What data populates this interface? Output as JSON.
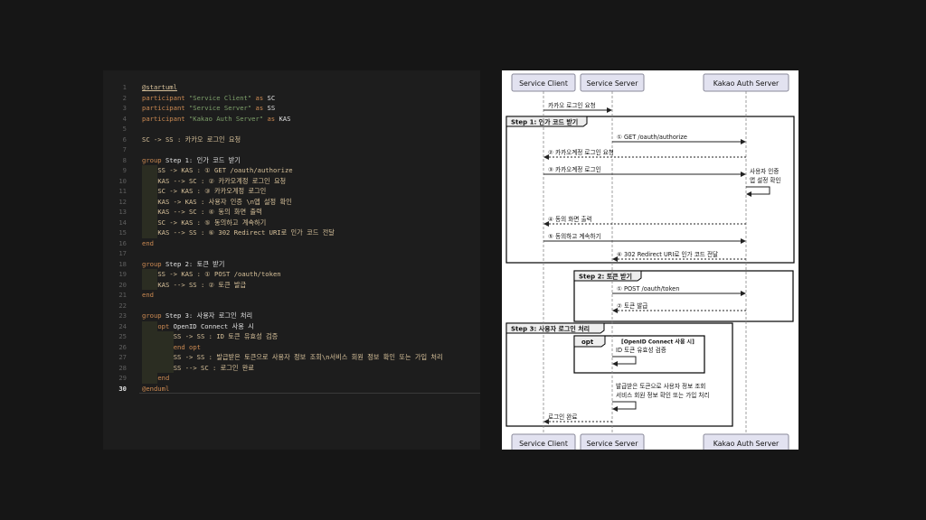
{
  "editor": {
    "current_line": 30,
    "lines": [
      [
        {
          "c": "at",
          "t": "@startuml"
        }
      ],
      [
        {
          "c": "kw",
          "t": "participant "
        },
        {
          "c": "str",
          "t": "\"Service Client\""
        },
        {
          "c": "kw",
          "t": " as "
        },
        {
          "c": "id",
          "t": "SC"
        }
      ],
      [
        {
          "c": "kw",
          "t": "participant "
        },
        {
          "c": "str",
          "t": "\"Service Server\""
        },
        {
          "c": "kw",
          "t": " as "
        },
        {
          "c": "id",
          "t": "SS"
        }
      ],
      [
        {
          "c": "kw",
          "t": "participant "
        },
        {
          "c": "str",
          "t": "\"Kakao Auth Server\""
        },
        {
          "c": "kw",
          "t": " as "
        },
        {
          "c": "id",
          "t": "KAS"
        }
      ],
      [],
      [
        {
          "c": "txt",
          "t": "SC -> SS : 카카오 로그인 요청"
        }
      ],
      [],
      [
        {
          "c": "kw",
          "t": "group "
        },
        {
          "c": "id",
          "t": "Step 1: 인가 코드 받기"
        }
      ],
      [
        {
          "c": "txt",
          "t": "SS -> KAS : ① GET /oauth/authorize"
        }
      ],
      [
        {
          "c": "txt",
          "t": "KAS --> SC : ② 카카오계정 로그인 요청"
        }
      ],
      [
        {
          "c": "txt",
          "t": "SC -> KAS : ③ 카카오계정 로그인"
        }
      ],
      [
        {
          "c": "txt",
          "t": "KAS -> KAS : 사용자 인증 \\n앱 설정 확인"
        }
      ],
      [
        {
          "c": "txt",
          "t": "KAS --> SC : ④ 동의 화면 출력"
        }
      ],
      [
        {
          "c": "txt",
          "t": "SC -> KAS : ⑤ 동의하고 계속하기"
        }
      ],
      [
        {
          "c": "txt",
          "t": "KAS --> SS : ⑥ 302 Redirect URI로 인가 코드 전달"
        }
      ],
      [
        {
          "c": "kw",
          "t": "end"
        }
      ],
      [],
      [
        {
          "c": "kw",
          "t": "group "
        },
        {
          "c": "id",
          "t": "Step 2: 토큰 받기"
        }
      ],
      [
        {
          "c": "txt",
          "t": "SS -> KAS : ① POST /oauth/token"
        }
      ],
      [
        {
          "c": "txt",
          "t": "KAS --> SS : ② 토큰 발급"
        }
      ],
      [
        {
          "c": "kw",
          "t": "end"
        }
      ],
      [],
      [
        {
          "c": "kw",
          "t": "group "
        },
        {
          "c": "id",
          "t": "Step 3: 사용자 로그인 처리"
        }
      ],
      [
        {
          "c": "kw",
          "t": "opt "
        },
        {
          "c": "id",
          "t": "OpenID Connect 사용 시"
        }
      ],
      [
        {
          "c": "txt",
          "t": "SS -> SS : ID 토큰 유효성 검증"
        }
      ],
      [
        {
          "c": "kw",
          "t": "end opt"
        }
      ],
      [
        {
          "c": "txt",
          "t": "SS -> SS : 발급받은 토큰으로 사용자 정보 조회\\n서비스 회원 정보 확인 또는 가입 처리"
        }
      ],
      [
        {
          "c": "txt",
          "t": "SS --> SC : 로그인 완료"
        }
      ],
      [
        {
          "c": "kw",
          "t": "end"
        }
      ],
      [
        {
          "c": "kw",
          "t": "@enduml"
        }
      ]
    ],
    "indent": [
      0,
      0,
      0,
      0,
      0,
      0,
      0,
      0,
      1,
      1,
      1,
      1,
      1,
      1,
      1,
      0,
      0,
      0,
      1,
      1,
      0,
      0,
      0,
      1,
      2,
      2,
      2,
      2,
      1,
      0
    ]
  },
  "diagram": {
    "participants": [
      "Service Client",
      "Service Server",
      "Kakao Auth Server"
    ],
    "groups": [
      {
        "label": "Step 1: 인가 코드 받기"
      },
      {
        "label": "Step 2: 토큰 받기"
      },
      {
        "label": "Step 3: 사용자 로그인 처리"
      }
    ],
    "opt": {
      "label": "opt",
      "condition": "[OpenID Connect 사용 시]"
    },
    "messages": [
      {
        "from": 0,
        "to": 1,
        "dashed": false,
        "lines": [
          "카카오 로그인 요청"
        ]
      },
      {
        "from": 1,
        "to": 2,
        "dashed": false,
        "lines": [
          "① GET /oauth/authorize"
        ]
      },
      {
        "from": 2,
        "to": 0,
        "dashed": true,
        "lines": [
          "② 카카오계정 로그인 요청"
        ]
      },
      {
        "from": 0,
        "to": 2,
        "dashed": false,
        "lines": [
          "③ 카카오계정 로그인"
        ]
      },
      {
        "from": 2,
        "to": 2,
        "dashed": false,
        "lines": [
          "사용자 인증",
          "앱 설정 확인"
        ]
      },
      {
        "from": 2,
        "to": 0,
        "dashed": true,
        "lines": [
          "④ 동의 화면 출력"
        ]
      },
      {
        "from": 0,
        "to": 2,
        "dashed": false,
        "lines": [
          "⑤ 동의하고 계속하기"
        ]
      },
      {
        "from": 2,
        "to": 1,
        "dashed": true,
        "lines": [
          "⑥ 302 Redirect URI로 인가 코드 전달"
        ]
      },
      {
        "from": 1,
        "to": 2,
        "dashed": false,
        "lines": [
          "① POST /oauth/token"
        ]
      },
      {
        "from": 2,
        "to": 1,
        "dashed": true,
        "lines": [
          "② 토큰 발급"
        ]
      },
      {
        "from": 1,
        "to": 1,
        "dashed": false,
        "lines": [
          "ID 토큰 유효성 검증"
        ]
      },
      {
        "from": 1,
        "to": 1,
        "dashed": false,
        "lines": [
          "발급받은 토큰으로 사용자 정보 조회",
          "서비스 회원 정보 확인 또는 가입 처리"
        ]
      },
      {
        "from": 1,
        "to": 0,
        "dashed": true,
        "lines": [
          "로그인 완료"
        ]
      }
    ]
  },
  "colors": {
    "background": "#161616",
    "editor_bg": "#1d1d1d",
    "participant_fill": "#e2e2f0",
    "participant_stroke": "#8a8a9a",
    "group_header": "#eeeeee"
  }
}
